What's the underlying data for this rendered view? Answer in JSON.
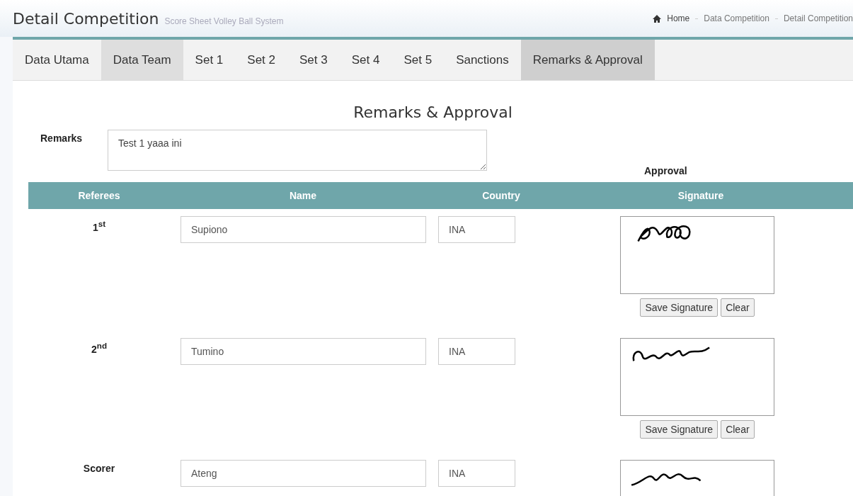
{
  "header": {
    "title": "Detail Competition",
    "subtitle": "Score Sheet Volley Ball System",
    "breadcrumb": [
      "Home",
      "Data Competition",
      "Detail Competition"
    ]
  },
  "tabs": [
    {
      "label": "Data Utama",
      "selected": false,
      "hovered": false
    },
    {
      "label": "Data Team",
      "selected": false,
      "hovered": true
    },
    {
      "label": "Set 1",
      "selected": false,
      "hovered": false
    },
    {
      "label": "Set 2",
      "selected": false,
      "hovered": false
    },
    {
      "label": "Set 3",
      "selected": false,
      "hovered": false
    },
    {
      "label": "Set 4",
      "selected": false,
      "hovered": false
    },
    {
      "label": "Set 5",
      "selected": false,
      "hovered": false
    },
    {
      "label": "Sanctions",
      "selected": false,
      "hovered": false
    },
    {
      "label": "Remarks & Approval",
      "selected": true,
      "hovered": false
    }
  ],
  "section_title": "Remarks & Approval",
  "remarks": {
    "label": "Remarks",
    "value": "Test 1 yaaa ini"
  },
  "approval_label": "Approval",
  "table": {
    "columns": [
      "Referees",
      "Name",
      "Country",
      "Signature"
    ],
    "rows": [
      {
        "role": "1$^{st}$",
        "name": "Supiono",
        "country": "INA",
        "buttons": [
          "Save Signature",
          "Clear"
        ]
      },
      {
        "role": "2$^{nd}$",
        "name": "Tumino",
        "country": "INA",
        "buttons": [
          "Save Signature",
          "Clear"
        ]
      },
      {
        "role": "Scorer",
        "name": "Ateng",
        "country": "INA"
      }
    ]
  }
}
